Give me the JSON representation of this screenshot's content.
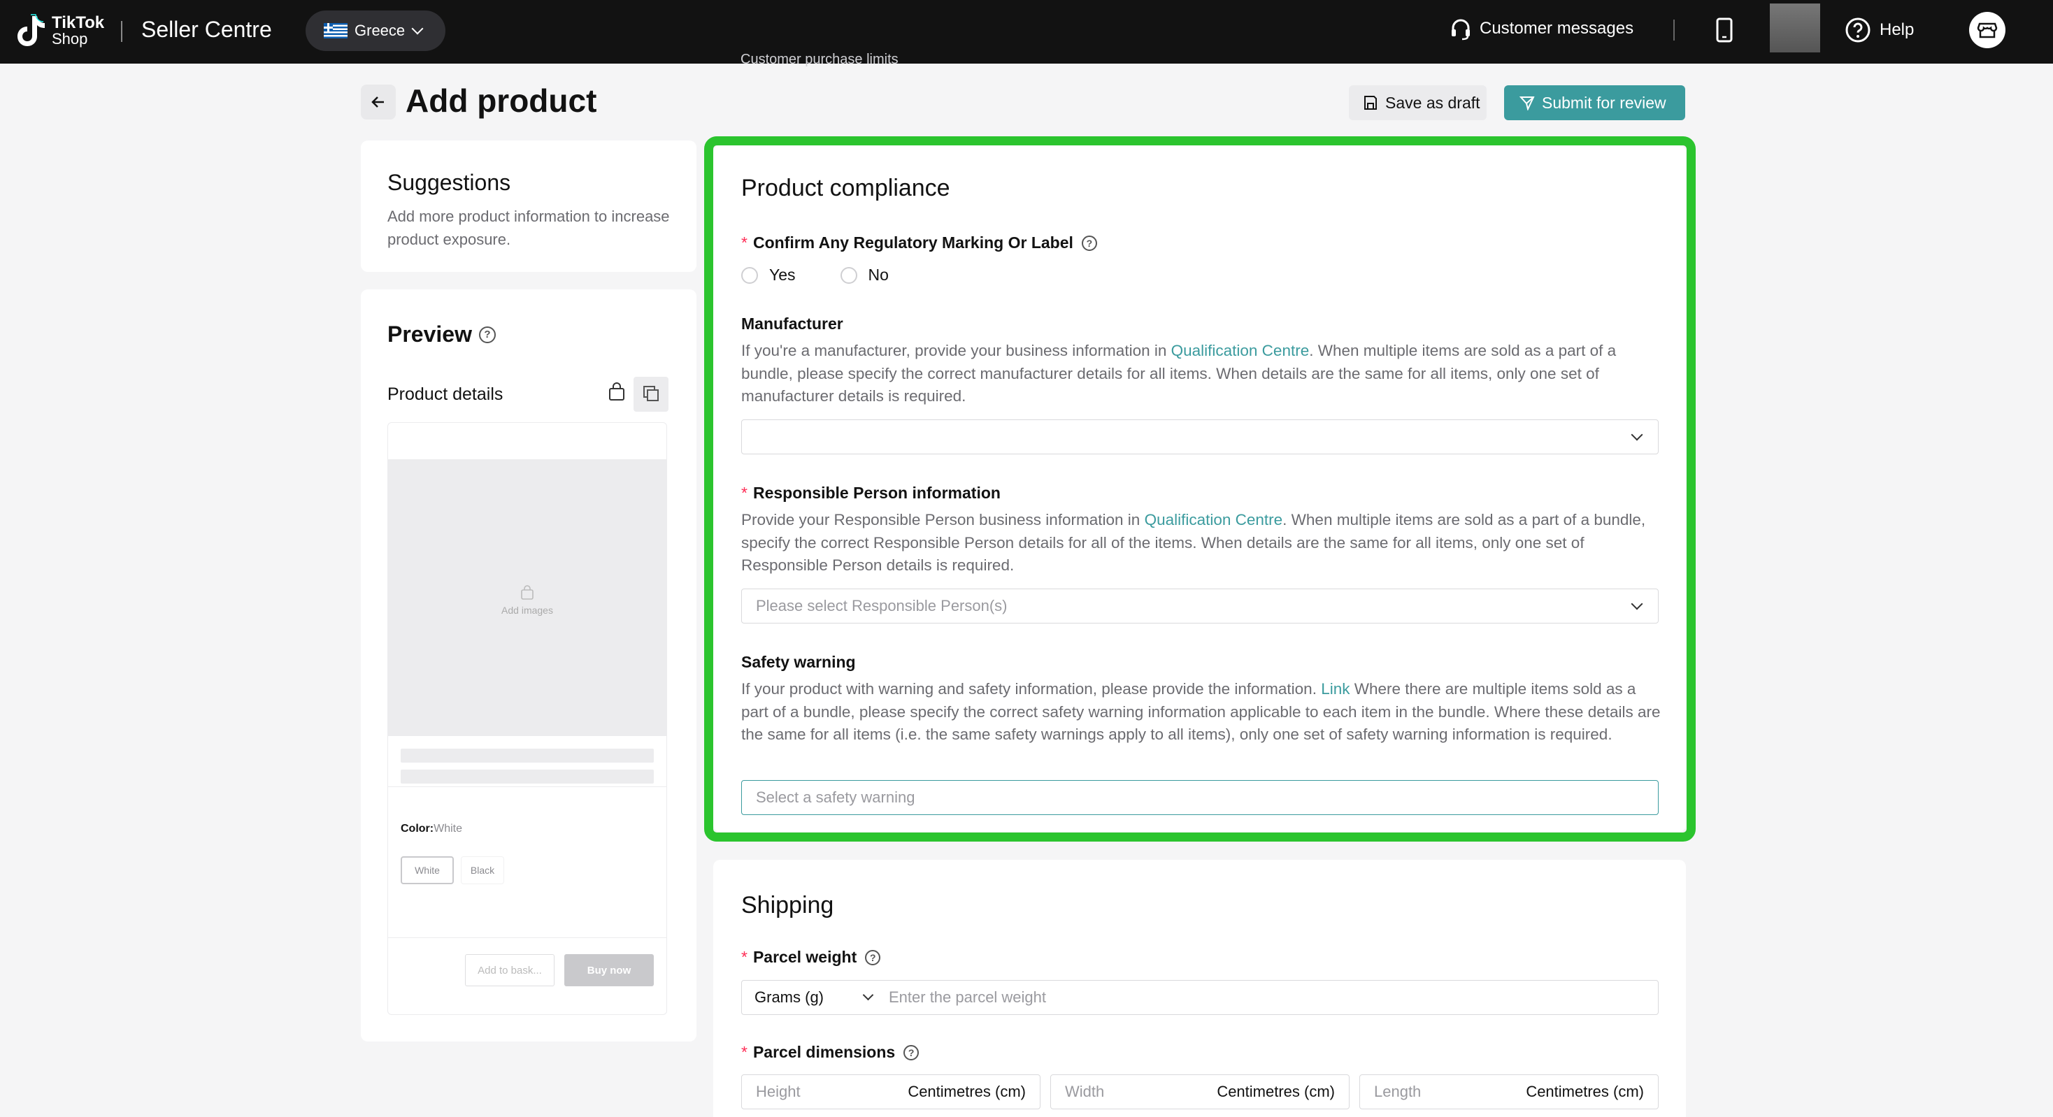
{
  "topbar": {
    "logo_line1": "TikTok",
    "logo_line2": "Shop",
    "app_name": "Seller Centre",
    "region": "Greece",
    "customer_messages": "Customer messages",
    "help": "Help"
  },
  "header": {
    "title": "Add product",
    "ghost_text": "Customer purchase limits",
    "save_draft": "Save as draft",
    "submit": "Submit for review"
  },
  "suggestions": {
    "title": "Suggestions",
    "text": "Add more product information to increase product exposure."
  },
  "preview": {
    "title": "Preview",
    "product_details": "Product details",
    "add_images": "Add images",
    "color_label": "Color:",
    "color_value": "White",
    "variants": [
      "White",
      "Black"
    ],
    "add_to_basket": "Add to bask...",
    "buy_now": "Buy now"
  },
  "compliance": {
    "title": "Product compliance",
    "regulatory_label": "Confirm Any Regulatory Marking Or Label",
    "yes": "Yes",
    "no": "No",
    "manufacturer_label": "Manufacturer",
    "manufacturer_desc_1": "If you're a manufacturer, provide your business information in ",
    "manufacturer_link": "Qualification Centre",
    "manufacturer_desc_2": ". When multiple items are sold as a part of a bundle, please specify the correct manufacturer details for all items. When details are the same for all items, only one set of manufacturer details is required.",
    "responsible_label": "Responsible Person information",
    "responsible_desc_1": "Provide your Responsible Person business information in ",
    "responsible_link": "Qualification Centre",
    "responsible_desc_2": ". When multiple items are sold as a part of a bundle, specify the correct Responsible Person details for all of the items. When details are the same for all items, only one set of Responsible Person details is required.",
    "responsible_placeholder": "Please select Responsible Person(s)",
    "safety_label": "Safety warning",
    "safety_desc_1": "If your product with warning and safety information, please provide the information. ",
    "safety_link": "Link",
    "safety_desc_2": " Where there are multiple items sold as a part of a bundle, please specify the correct safety warning information applicable to each item in the bundle. Where these details are the same for all items (i.e. the same safety warnings apply to all items), only one set of safety warning information is required.",
    "safety_placeholder": "Select a safety warning"
  },
  "shipping": {
    "title": "Shipping",
    "weight_label": "Parcel weight",
    "weight_unit": "Grams (g)",
    "weight_placeholder": "Enter the parcel weight",
    "dimensions_label": "Parcel dimensions",
    "height": "Height",
    "width": "Width",
    "length": "Length",
    "dim_unit": "Centimetres (cm)"
  },
  "colors": {
    "accent": "#3b9b9e",
    "highlight": "#2bc42e",
    "required": "#fe2c55"
  }
}
